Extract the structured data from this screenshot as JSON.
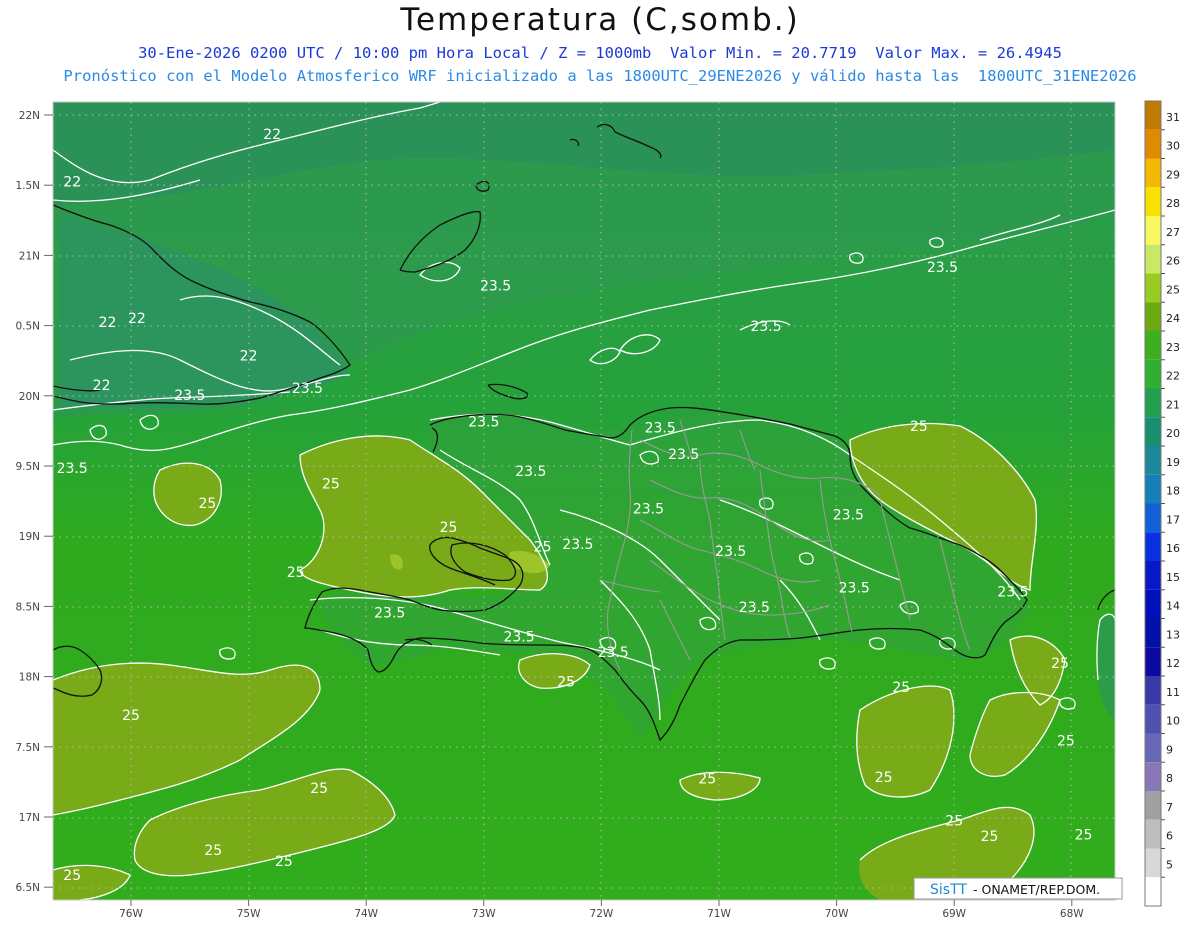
{
  "title": "Temperatura (C,somb.)",
  "subtitle1": "30-Ene-2026 0200 UTC / 10:00 pm Hora Local / Z = 1000mb  Valor Min. = 20.7719  Valor Max. = 26.4945",
  "subtitle2": "Pronóstico con el Modelo Atmosferico WRF inicializado a las 1800UTC_29ENE2026 y válido hasta las  1800UTC_31ENE2026",
  "lat_labels": [
    "22N",
    "1.5N",
    "21N",
    "0.5N",
    "20N",
    "9.5N",
    "19N",
    "8.5N",
    "18N",
    "7.5N",
    "17N",
    "6.5N"
  ],
  "lon_labels": [
    "76W",
    "75W",
    "74W",
    "73W",
    "72W",
    "71W",
    "70W",
    "69W",
    "68W"
  ],
  "contour_labels": [
    {
      "text": "22",
      "lon": -74.8,
      "lat": 21.83
    },
    {
      "text": "22",
      "lon": -76.5,
      "lat": 21.49
    },
    {
      "text": "22",
      "lon": -76.2,
      "lat": 20.49
    },
    {
      "text": "22",
      "lon": -75.95,
      "lat": 20.52
    },
    {
      "text": "22",
      "lon": -75.0,
      "lat": 20.25
    },
    {
      "text": "22",
      "lon": -76.25,
      "lat": 20.04
    },
    {
      "text": "23.5",
      "lon": -72.9,
      "lat": 20.75
    },
    {
      "text": "23.5",
      "lon": -70.6,
      "lat": 20.46
    },
    {
      "text": "23.5",
      "lon": -69.1,
      "lat": 20.88
    },
    {
      "text": "23.5",
      "lon": -75.5,
      "lat": 19.97
    },
    {
      "text": "23.5",
      "lon": -74.5,
      "lat": 20.02
    },
    {
      "text": "23.5",
      "lon": -73.0,
      "lat": 19.78
    },
    {
      "text": "23.5",
      "lon": -72.6,
      "lat": 19.43
    },
    {
      "text": "23.5",
      "lon": -71.5,
      "lat": 19.74
    },
    {
      "text": "23.5",
      "lon": -71.3,
      "lat": 19.55
    },
    {
      "text": "23.5",
      "lon": -71.6,
      "lat": 19.16
    },
    {
      "text": "23.5",
      "lon": -72.2,
      "lat": 18.91
    },
    {
      "text": "23.5",
      "lon": -70.9,
      "lat": 18.86
    },
    {
      "text": "23.5",
      "lon": -70.7,
      "lat": 18.46
    },
    {
      "text": "23.5",
      "lon": -69.9,
      "lat": 19.12
    },
    {
      "text": "23.5",
      "lon": -69.85,
      "lat": 18.6
    },
    {
      "text": "23.5",
      "lon": -76.5,
      "lat": 19.45
    },
    {
      "text": "23.5",
      "lon": -73.8,
      "lat": 18.42
    },
    {
      "text": "23.5",
      "lon": -72.7,
      "lat": 18.25
    },
    {
      "text": "23.5",
      "lon": -71.9,
      "lat": 18.14
    },
    {
      "text": "23.5",
      "lon": -68.5,
      "lat": 18.57
    },
    {
      "text": "25",
      "lon": -69.3,
      "lat": 19.75
    },
    {
      "text": "25",
      "lon": -74.3,
      "lat": 19.34
    },
    {
      "text": "25",
      "lon": -75.35,
      "lat": 19.2
    },
    {
      "text": "25",
      "lon": -73.3,
      "lat": 19.03
    },
    {
      "text": "25",
      "lon": -72.5,
      "lat": 18.89
    },
    {
      "text": "25",
      "lon": -74.6,
      "lat": 18.71
    },
    {
      "text": "25",
      "lon": -72.3,
      "lat": 17.93
    },
    {
      "text": "25",
      "lon": -76.0,
      "lat": 17.69
    },
    {
      "text": "25",
      "lon": -68.1,
      "lat": 18.06
    },
    {
      "text": "25",
      "lon": -69.45,
      "lat": 17.89
    },
    {
      "text": "25",
      "lon": -68.05,
      "lat": 17.51
    },
    {
      "text": "25",
      "lon": -71.1,
      "lat": 17.24
    },
    {
      "text": "25",
      "lon": -74.4,
      "lat": 17.17
    },
    {
      "text": "25",
      "lon": -69.6,
      "lat": 17.25
    },
    {
      "text": "25",
      "lon": -69.0,
      "lat": 16.94
    },
    {
      "text": "25",
      "lon": -75.3,
      "lat": 16.73
    },
    {
      "text": "25",
      "lon": -74.7,
      "lat": 16.65
    },
    {
      "text": "25",
      "lon": -68.7,
      "lat": 16.83
    },
    {
      "text": "25",
      "lon": -67.9,
      "lat": 16.84
    },
    {
      "text": "25",
      "lon": -76.5,
      "lat": 16.55
    }
  ],
  "colorbar": {
    "labels": [
      "31",
      "30",
      "29",
      "28",
      "27",
      "26",
      "25",
      "24",
      "23",
      "22",
      "21",
      "20",
      "19",
      "18",
      "17",
      "16",
      "15",
      "14",
      "13",
      "12",
      "11",
      "10",
      "9",
      "8",
      "7",
      "6",
      "5"
    ],
    "colors": [
      "#c07a00",
      "#e08a00",
      "#f5b800",
      "#f8e000",
      "#f8f860",
      "#c9e866",
      "#98cc20",
      "#6ca810",
      "#3db020",
      "#30b030",
      "#20a050",
      "#189070",
      "#1a8898",
      "#1580b8",
      "#1060d8",
      "#0830e0",
      "#0818c8",
      "#0010b8",
      "#0010a8",
      "#0a0aa0",
      "#3838a8",
      "#5050b0",
      "#6868b8",
      "#8878b8",
      "#a0a0a0",
      "#bebebe",
      "#d8d8d8",
      "#ffffff"
    ]
  },
  "credit": {
    "brand": "SisTT",
    "text": " - ONAMET/REP.DOM."
  },
  "colors": {
    "sea_dark": "#2e9a52",
    "sea_mid": "#22a230",
    "sea_main": "#2faa1f",
    "warm": "#78ab17",
    "warm_light": "#9bc52a",
    "coast": "#111111",
    "border": "#9a9a9a",
    "contour": "#ffffff"
  }
}
